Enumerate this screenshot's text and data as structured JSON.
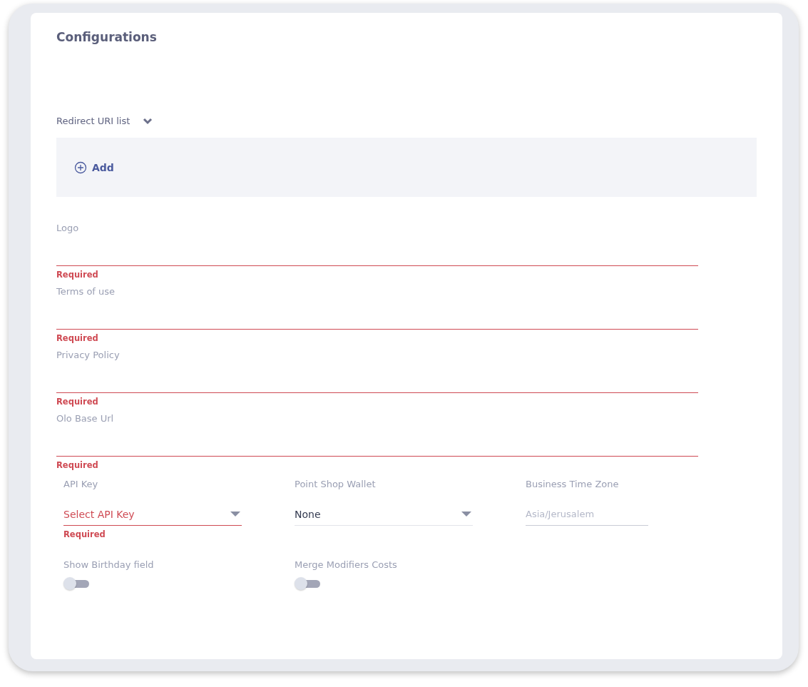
{
  "title": "Configurations",
  "redirect_uri_list": {
    "label": "Redirect URI list",
    "expanded": true,
    "add_button": "Add"
  },
  "text_fields": [
    {
      "label": "Logo",
      "error": "Required"
    },
    {
      "label": "Terms of use",
      "error": "Required"
    },
    {
      "label": "Privacy Policy",
      "error": "Required"
    },
    {
      "label": "Olo Base Url",
      "error": "Required"
    }
  ],
  "settings": [
    {
      "kind": "select",
      "label": "API Key",
      "placeholder": "Select API Key",
      "error": "Required"
    },
    {
      "kind": "select",
      "label": "Point Shop Wallet",
      "value": "None"
    },
    {
      "kind": "text",
      "label": "Business Time Zone",
      "placeholder": "Asia/Jerusalem"
    }
  ],
  "toggles": [
    {
      "label": "Show Birthday field",
      "on": false
    },
    {
      "label": "Merge Modifiers Costs",
      "on": false
    }
  ]
}
